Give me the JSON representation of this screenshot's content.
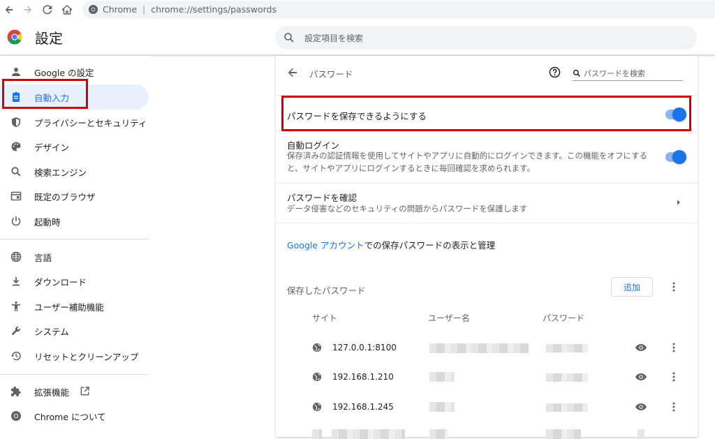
{
  "browser": {
    "chip": "Chrome",
    "separator": "|",
    "url": "chrome://settings/passwords"
  },
  "header": {
    "title": "設定",
    "search_placeholder": "設定項目を検索"
  },
  "sidebar": {
    "items": [
      {
        "label": "Google の設定",
        "icon": "person-icon"
      },
      {
        "label": "自動入力",
        "icon": "clipboard-icon",
        "active": true
      },
      {
        "label": "プライバシーとセキュリティ",
        "icon": "shield-icon"
      },
      {
        "label": "デザイン",
        "icon": "palette-icon"
      },
      {
        "label": "検索エンジン",
        "icon": "search-icon"
      },
      {
        "label": "既定のブラウザ",
        "icon": "browser-window-icon"
      },
      {
        "label": "起動時",
        "icon": "power-icon"
      },
      {
        "label": "言語",
        "icon": "globe-icon"
      },
      {
        "label": "ダウンロード",
        "icon": "download-icon"
      },
      {
        "label": "ユーザー補助機能",
        "icon": "accessibility-icon"
      },
      {
        "label": "システム",
        "icon": "wrench-icon"
      },
      {
        "label": "リセットとクリーンアップ",
        "icon": "history-icon"
      },
      {
        "label": "拡張機能",
        "icon": "puzzle-icon"
      },
      {
        "label": "Chrome について",
        "icon": "chrome-icon"
      }
    ]
  },
  "passwords": {
    "title": "パスワード",
    "search_placeholder": "パスワードを検索",
    "offer_save": "パスワードを保存できるようにする",
    "auto_signin_title": "自動ログイン",
    "auto_signin_desc": "保存済みの認証情報を使用してサイトやアプリに自動的にログインできます。この機能をオフにすると、サイトやアプリにログインするときに毎回確認を求められます。",
    "check_title": "パスワードを確認",
    "check_desc": "データ侵害などのセキュリティの問題からパスワードを保護します",
    "account_link": "Google アカウント",
    "account_text": "での保存パスワードの表示と管理",
    "saved_title": "保存したパスワード",
    "add_button": "追加",
    "columns": [
      "サイト",
      "ユーザー名",
      "パスワード"
    ],
    "rows": [
      {
        "site": "127.0.0.1:8100"
      },
      {
        "site": "192.168.1.210"
      },
      {
        "site": "192.168.1.245"
      }
    ]
  },
  "colors": {
    "accent": "#1a73e8",
    "highlight": "#d00000",
    "active_bg": "#e8f0fe"
  }
}
